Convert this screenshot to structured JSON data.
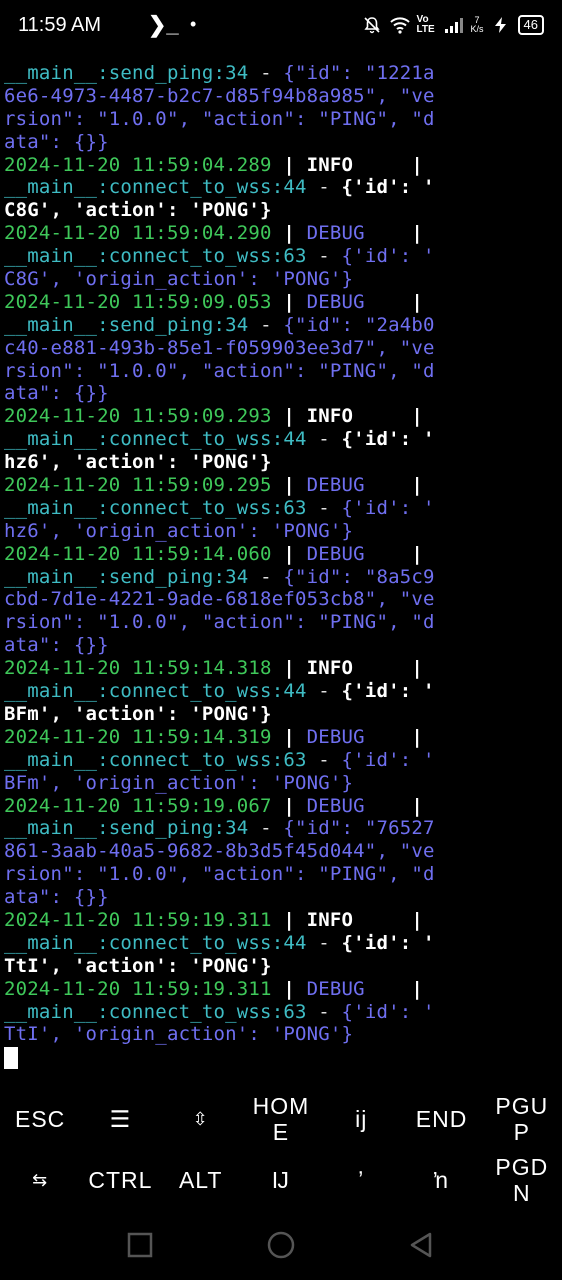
{
  "status_bar": {
    "time": "11:59 AM",
    "terminal_glyph": "❯_",
    "dot": "•",
    "net_speed_value": "7",
    "net_speed_unit": "K/s",
    "volte": "Vo LTE",
    "battery": "46"
  },
  "terminal": {
    "lines": [
      {
        "func": "__main__:send_ping",
        "lineno": ":34",
        "dash": " - ",
        "msgclass": "msg-debug",
        "msg": "{\"id\": \"1221a"
      },
      {
        "msgclass": "msg-debug",
        "msg": "6e6-4973-4487-b2c7-d85f94b8a985\", \"ve"
      },
      {
        "msgclass": "msg-debug",
        "msg": "rsion\": \"1.0.0\", \"action\": \"PING\", \"d"
      },
      {
        "msgclass": "msg-debug",
        "msg": "ata\": {}}"
      },
      {
        "ts": "2024-11-20 11:59:04.289",
        "sep1": " | ",
        "level": "INFO    ",
        "lvlclass": "lvl-info",
        "sep2": " |"
      },
      {
        "func": "__main__:connect_to_wss",
        "lineno": ":44",
        "dash": " - ",
        "msgclass": "msg-info",
        "msg": "{'id': '"
      },
      {
        "msgclass": "msg-info",
        "msg": "C8G', 'action': 'PONG'}"
      },
      {
        "ts": "2024-11-20 11:59:04.290",
        "sep1": " | ",
        "level": "DEBUG   ",
        "lvlclass": "lvl-debug",
        "sep2": " |"
      },
      {
        "func": "__main__:connect_to_wss",
        "lineno": ":63",
        "dash": " - ",
        "msgclass": "msg-debug",
        "msg": "{'id': '"
      },
      {
        "msgclass": "msg-debug",
        "msg": "C8G', 'origin_action': 'PONG'}"
      },
      {
        "ts": "2024-11-20 11:59:09.053",
        "sep1": " | ",
        "level": "DEBUG   ",
        "lvlclass": "lvl-debug",
        "sep2": " |"
      },
      {
        "func": "__main__:send_ping",
        "lineno": ":34",
        "dash": " - ",
        "msgclass": "msg-debug",
        "msg": "{\"id\": \"2a4b0"
      },
      {
        "msgclass": "msg-debug",
        "msg": "c40-e881-493b-85e1-f059903ee3d7\", \"ve"
      },
      {
        "msgclass": "msg-debug",
        "msg": "rsion\": \"1.0.0\", \"action\": \"PING\", \"d"
      },
      {
        "msgclass": "msg-debug",
        "msg": "ata\": {}}"
      },
      {
        "ts": "2024-11-20 11:59:09.293",
        "sep1": " | ",
        "level": "INFO    ",
        "lvlclass": "lvl-info",
        "sep2": " |"
      },
      {
        "func": "__main__:connect_to_wss",
        "lineno": ":44",
        "dash": " - ",
        "msgclass": "msg-info",
        "msg": "{'id': '"
      },
      {
        "msgclass": "msg-info",
        "msg": "hz6', 'action': 'PONG'}"
      },
      {
        "ts": "2024-11-20 11:59:09.295",
        "sep1": " | ",
        "level": "DEBUG   ",
        "lvlclass": "lvl-debug",
        "sep2": " |"
      },
      {
        "func": "__main__:connect_to_wss",
        "lineno": ":63",
        "dash": " - ",
        "msgclass": "msg-debug",
        "msg": "{'id': '"
      },
      {
        "msgclass": "msg-debug",
        "msg": "hz6', 'origin_action': 'PONG'}"
      },
      {
        "ts": "2024-11-20 11:59:14.060",
        "sep1": " | ",
        "level": "DEBUG   ",
        "lvlclass": "lvl-debug",
        "sep2": " |"
      },
      {
        "func": "__main__:send_ping",
        "lineno": ":34",
        "dash": " - ",
        "msgclass": "msg-debug",
        "msg": "{\"id\": \"8a5c9"
      },
      {
        "msgclass": "msg-debug",
        "msg": "cbd-7d1e-4221-9ade-6818ef053cb8\", \"ve"
      },
      {
        "msgclass": "msg-debug",
        "msg": "rsion\": \"1.0.0\", \"action\": \"PING\", \"d"
      },
      {
        "msgclass": "msg-debug",
        "msg": "ata\": {}}"
      },
      {
        "ts": "2024-11-20 11:59:14.318",
        "sep1": " | ",
        "level": "INFO    ",
        "lvlclass": "lvl-info",
        "sep2": " |"
      },
      {
        "func": "__main__:connect_to_wss",
        "lineno": ":44",
        "dash": " - ",
        "msgclass": "msg-info",
        "msg": "{'id': '"
      },
      {
        "msgclass": "msg-info",
        "msg": "BFm', 'action': 'PONG'}"
      },
      {
        "ts": "2024-11-20 11:59:14.319",
        "sep1": " | ",
        "level": "DEBUG   ",
        "lvlclass": "lvl-debug",
        "sep2": " |"
      },
      {
        "func": "__main__:connect_to_wss",
        "lineno": ":63",
        "dash": " - ",
        "msgclass": "msg-debug",
        "msg": "{'id': '"
      },
      {
        "msgclass": "msg-debug",
        "msg": "BFm', 'origin_action': 'PONG'}"
      },
      {
        "ts": "2024-11-20 11:59:19.067",
        "sep1": " | ",
        "level": "DEBUG   ",
        "lvlclass": "lvl-debug",
        "sep2": " |"
      },
      {
        "func": "__main__:send_ping",
        "lineno": ":34",
        "dash": " - ",
        "msgclass": "msg-debug",
        "msg": "{\"id\": \"76527"
      },
      {
        "msgclass": "msg-debug",
        "msg": "861-3aab-40a5-9682-8b3d5f45d044\", \"ve"
      },
      {
        "msgclass": "msg-debug",
        "msg": "rsion\": \"1.0.0\", \"action\": \"PING\", \"d"
      },
      {
        "msgclass": "msg-debug",
        "msg": "ata\": {}}"
      },
      {
        "ts": "2024-11-20 11:59:19.311",
        "sep1": " | ",
        "level": "INFO    ",
        "lvlclass": "lvl-info",
        "sep2": " |"
      },
      {
        "func": "__main__:connect_to_wss",
        "lineno": ":44",
        "dash": " - ",
        "msgclass": "msg-info",
        "msg": "{'id': '"
      },
      {
        "msgclass": "msg-info",
        "msg": "TtI', 'action': 'PONG'}"
      },
      {
        "ts": "2024-11-20 11:59:19.311",
        "sep1": " | ",
        "level": "DEBUG   ",
        "lvlclass": "lvl-debug",
        "sep2": " |"
      },
      {
        "func": "__main__:connect_to_wss",
        "lineno": ":63",
        "dash": " - ",
        "msgclass": "msg-debug",
        "msg": "{'id': '"
      },
      {
        "msgclass": "msg-debug",
        "msg": "TtI', 'origin_action': 'PONG'}"
      }
    ]
  },
  "extra_keys": {
    "row1": [
      "ESC",
      "☰",
      "⇳",
      "HOM\nE",
      "ij",
      "END",
      "PGU\nP"
    ],
    "row2": [
      "⇆",
      "CTRL",
      "ALT",
      "Ĳ",
      "ʼ",
      "ŉ",
      "PGD\nN"
    ]
  },
  "colors": {
    "background": "#000000",
    "timestamp": "#3fc85a",
    "function": "#3fbcc4",
    "debug": "#6f6ff0",
    "info": "#ffffff"
  },
  "icons": {
    "mute": "bell-off-icon",
    "wifi": "wifi-icon",
    "signal": "signal-icon",
    "battery": "battery-icon",
    "nav_recents": "square-icon",
    "nav_home": "circle-icon",
    "nav_back": "triangle-back-icon"
  }
}
